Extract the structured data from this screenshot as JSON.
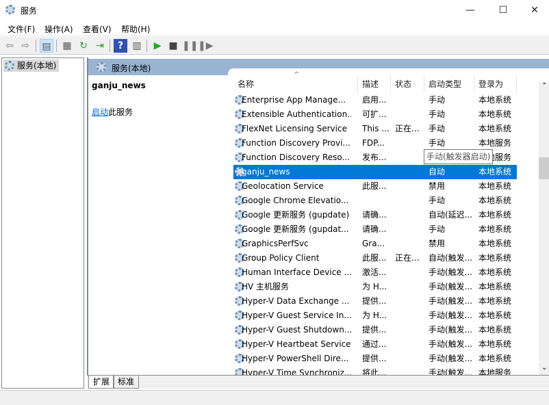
{
  "window": {
    "title": "服务",
    "minimize": "—",
    "maximize": "☐",
    "close": "✕"
  },
  "menu": [
    "文件(F)",
    "操作(A)",
    "查看(V)",
    "帮助(H)"
  ],
  "toolbar": {
    "icons": [
      "back-icon",
      "forward-icon",
      "show-hide-tree-icon",
      "properties-icon",
      "refresh-icon",
      "export-list-icon",
      "help-icon",
      "console-icon",
      "start-icon",
      "stop-icon",
      "pause-icon",
      "resume-icon"
    ]
  },
  "tree": {
    "root": "服务(本地)"
  },
  "pane": {
    "header": "服务(本地)",
    "selected_name": "ganju_news",
    "action_link": "启动",
    "action_suffix": "此服务"
  },
  "columns": [
    "名称",
    "描述",
    "状态",
    "启动类型",
    "登录为"
  ],
  "tooltip": "手动(触发器启动)",
  "rows": [
    [
      "Enterprise App Manage...",
      "启用...",
      "",
      "手动",
      "本地系统"
    ],
    [
      "Extensible Authentication...",
      "可扩...",
      "",
      "手动",
      "本地系统"
    ],
    [
      "FlexNet Licensing Service",
      "This ...",
      "正在...",
      "手动",
      "本地系统"
    ],
    [
      "Function Discovery Provi...",
      "FDP...",
      "",
      "手动",
      "本地服务"
    ],
    [
      "Function Discovery Reso...",
      "发布...",
      "",
      "手动(触发...",
      "本地服务"
    ],
    [
      "ganju_news",
      "",
      "",
      "自动",
      "本地系统"
    ],
    [
      "Geolocation Service",
      "此服...",
      "",
      "禁用",
      "本地系统"
    ],
    [
      "Google Chrome Elevatio...",
      "",
      "",
      "手动",
      "本地系统"
    ],
    [
      "Google 更新服务 (gupdate)",
      "请确...",
      "",
      "自动(延迟...",
      "本地系统"
    ],
    [
      "Google 更新服务 (gupdat...",
      "请确...",
      "",
      "手动",
      "本地系统"
    ],
    [
      "GraphicsPerfSvc",
      "Gra...",
      "",
      "禁用",
      "本地系统"
    ],
    [
      "Group Policy Client",
      "此服...",
      "正在...",
      "自动(触发...",
      "本地系统"
    ],
    [
      "Human Interface Device ...",
      "激活...",
      "",
      "手动(触发...",
      "本地系统"
    ],
    [
      "HV 主机服务",
      "为 H...",
      "",
      "手动(触发...",
      "本地系统"
    ],
    [
      "Hyper-V Data Exchange ...",
      "提供...",
      "",
      "手动(触发...",
      "本地系统"
    ],
    [
      "Hyper-V Guest Service In...",
      "为 H...",
      "",
      "手动(触发...",
      "本地系统"
    ],
    [
      "Hyper-V Guest Shutdown...",
      "提供...",
      "",
      "手动(触发...",
      "本地系统"
    ],
    [
      "Hyper-V Heartbeat Service",
      "通过...",
      "",
      "手动(触发...",
      "本地系统"
    ],
    [
      "Hyper-V PowerShell Dire...",
      "提供...",
      "",
      "手动(触发...",
      "本地系统"
    ],
    [
      "Hyper-V Time Synchroniz...",
      "将此...",
      "",
      "手动(触发...",
      "本地服务"
    ]
  ],
  "selected_row": 5,
  "tabs": [
    "扩展",
    "标准"
  ],
  "colors": {
    "selection": "#0078d7",
    "pane_header": "#99b4d1"
  }
}
